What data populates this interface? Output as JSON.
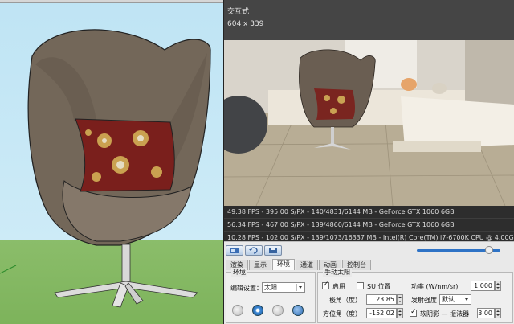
{
  "render": {
    "mode_title": "交互式",
    "resolution": "604 x 339",
    "stats": [
      "49.38 FPS - 395.00 S/PX - 140/4831/6144 MB - GeForce GTX 1060 6GB",
      "56.34 FPS - 467.00 S/PX - 139/4860/6144 MB - GeForce GTX 1060 6GB",
      "10.28 FPS - 102.00 S/PX - 139/1073/16337 MB - Intel(R) Core(TM) i7-6700K CPU @ 4.00GHz"
    ]
  },
  "toolbar": {
    "icons": [
      "render-region-icon",
      "refresh-icon",
      "save-image-icon"
    ],
    "slider_value": 0.9
  },
  "tabs": [
    "渲染",
    "显示",
    "环境",
    "通道",
    "动画",
    "控制台"
  ],
  "active_tab": 2,
  "environment": {
    "group_title": "环境",
    "setting_label": "编辑设置：",
    "setting_value": "太阳",
    "icons": [
      "sun-sky-icon",
      "hdri-icon",
      "gradient-icon",
      "globe-icon"
    ]
  },
  "sun": {
    "group_title": "手动太阳",
    "enable_label": "启用",
    "enable_checked": true,
    "su_position_label": "SU 位置",
    "su_position_checked": false,
    "elevation_label": "极角（度）",
    "elevation_value": "23.85",
    "azimuth_label": "方位角（度）",
    "azimuth_value": "-152.02",
    "power_label": "功率 (W/nm/sr)",
    "power_value": "1.000",
    "emission_label": "发射强度",
    "emission_value": "默认",
    "soft_shadow_label": "软阴影 — 振法器",
    "soft_shadow_checked": true,
    "soft_shadow_value": "3.00"
  },
  "colors": {
    "accent": "#2e73c6",
    "chair_fabric": "#6f6358",
    "pillow": "#7a1f1c"
  }
}
